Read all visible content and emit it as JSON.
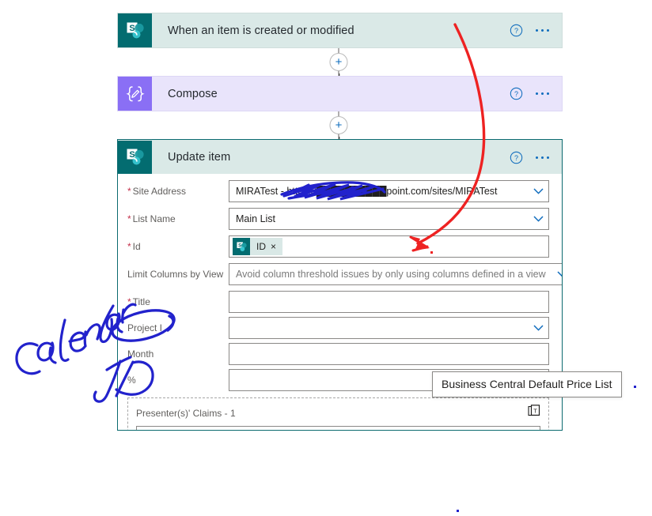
{
  "flow": {
    "cards": [
      {
        "id": "trigger",
        "title": "When an item is created or modified",
        "icon": "sharepoint-icon",
        "help_label": "?",
        "menu_label": "More commands"
      },
      {
        "id": "compose",
        "title": "Compose",
        "icon": "compose-braces-pencil-icon",
        "help_label": "?",
        "menu_label": "More commands"
      },
      {
        "id": "update",
        "title": "Update item",
        "icon": "sharepoint-icon",
        "help_label": "?",
        "menu_label": "More commands"
      }
    ],
    "add_step_label": "+"
  },
  "update_item_form": {
    "fields": [
      {
        "label": "Site Address",
        "required": true,
        "value": "MIRATest - https://██████████point.com/sites/MIRATest",
        "placeholder": "",
        "type": "combobox"
      },
      {
        "label": "List Name",
        "required": true,
        "value": "Main List",
        "placeholder": "",
        "type": "combobox"
      },
      {
        "label": "Id",
        "required": true,
        "value": "",
        "placeholder": "",
        "type": "token",
        "token": {
          "text": "ID",
          "icon": "sharepoint-icon",
          "remove_label": "×"
        }
      },
      {
        "label": "Limit Columns by View",
        "required": false,
        "value": "",
        "placeholder": "Avoid column threshold issues by only using columns defined in a view",
        "type": "combobox"
      },
      {
        "label": "Title",
        "required": true,
        "value": "",
        "placeholder": "",
        "type": "text"
      },
      {
        "label": "Project I",
        "required": false,
        "value": "",
        "placeholder": "",
        "type": "combobox"
      },
      {
        "label": "Month",
        "required": false,
        "value": "",
        "placeholder": "",
        "type": "text"
      },
      {
        "label": "%",
        "required": false,
        "value": "",
        "placeholder": "",
        "type": "text"
      }
    ],
    "repeating_section": {
      "title": "Presenter(s)' Claims - 1",
      "delete_label": "Delete item"
    }
  },
  "tooltip": {
    "text": "Business Central Default Price List"
  },
  "annotations": {
    "handwriting": "Calendar ID",
    "ink_blue_color": "#2222cc",
    "ink_red_color": "#ee2222",
    "circled_field": "Project I",
    "arrow_target": "Id"
  },
  "colors": {
    "sharepoint_teal": "#036c70",
    "sharepoint_header_bg": "#dae9e7",
    "compose_purple": "#8a6ff5",
    "compose_header_bg": "#e9e4fb",
    "selected_border": "#0b6a6f",
    "accent_blue": "#0f6cbd",
    "required_red": "#c4314b"
  }
}
